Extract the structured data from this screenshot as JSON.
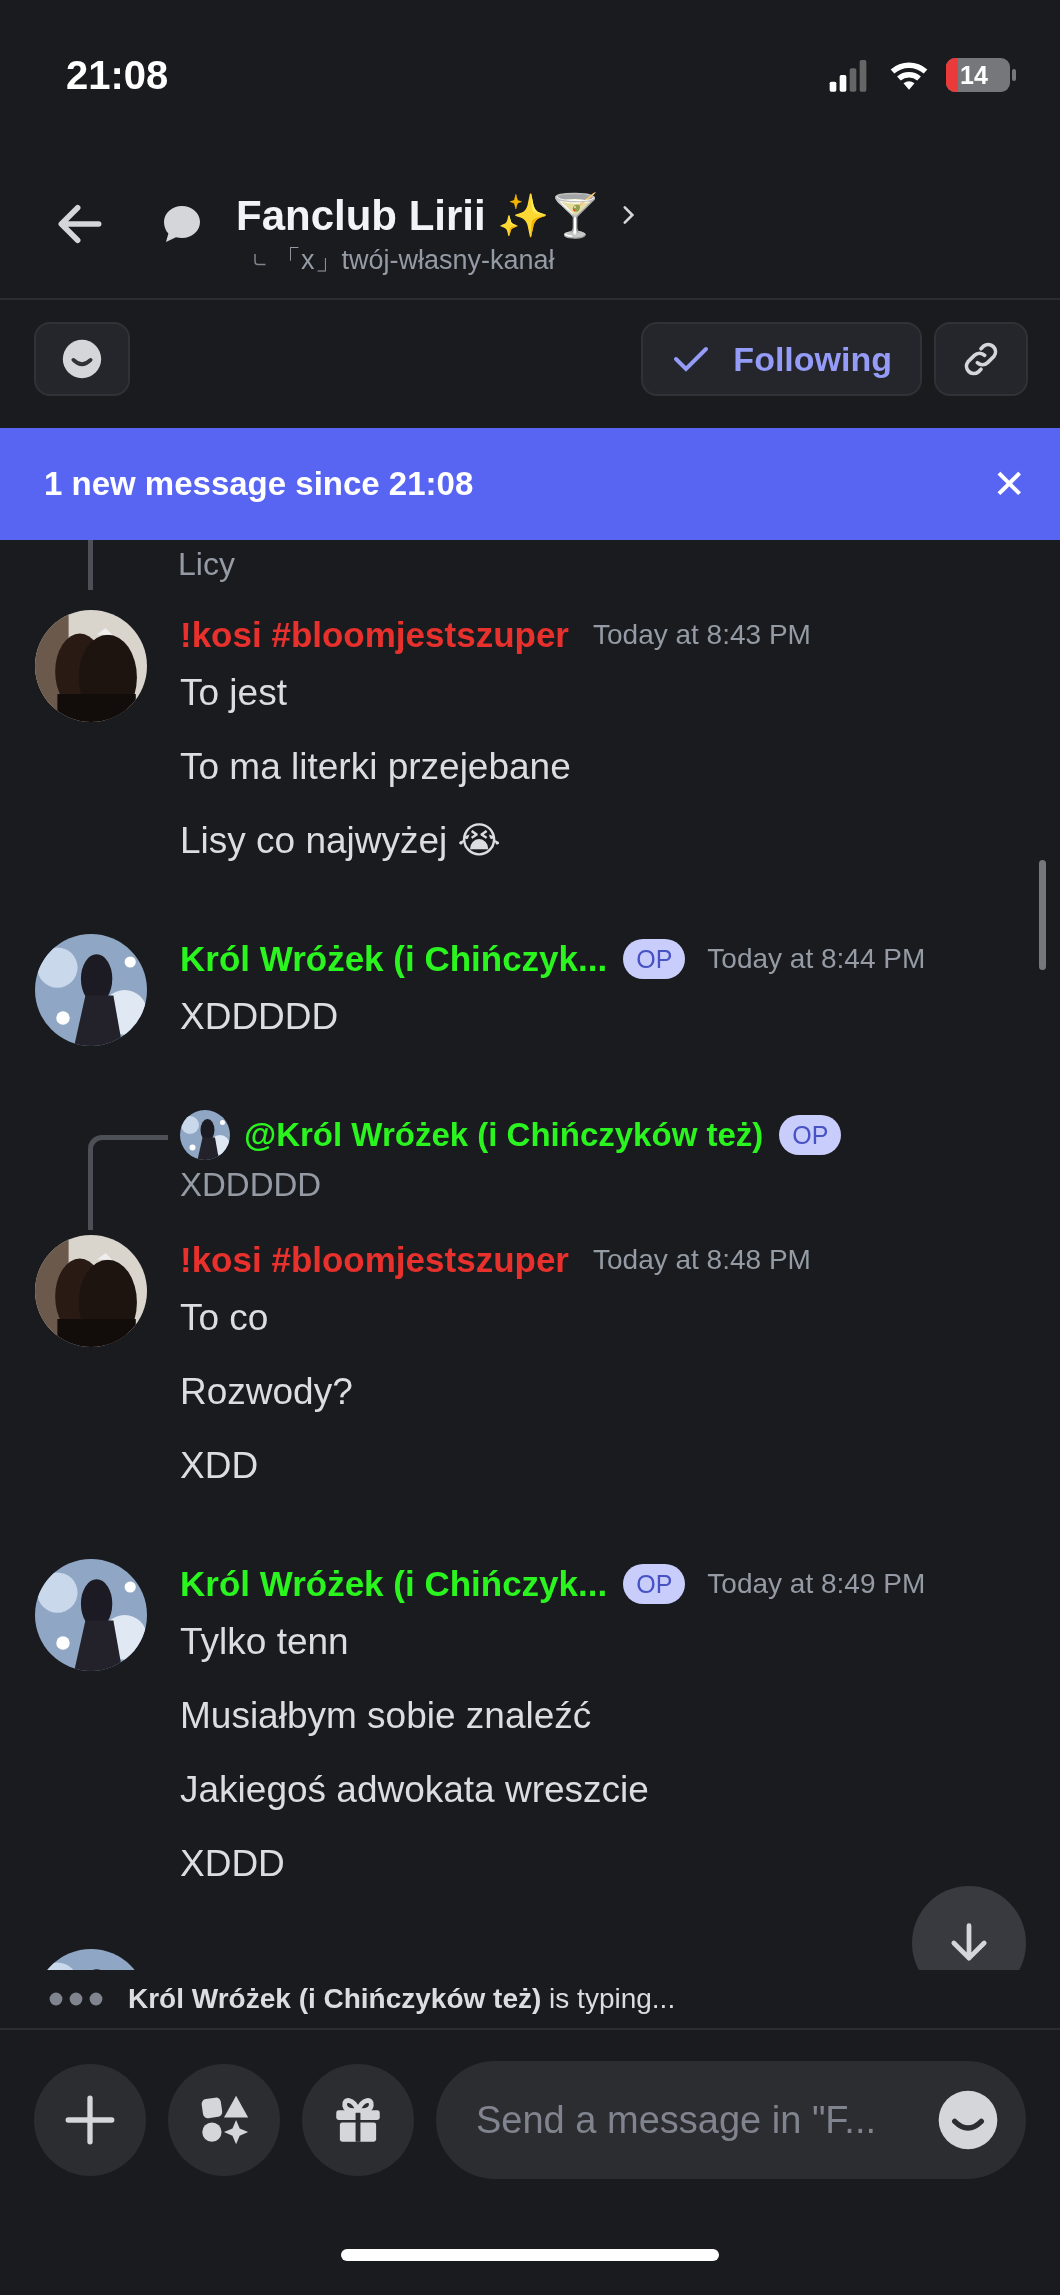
{
  "status_bar": {
    "time": "21:08",
    "battery": "14"
  },
  "header": {
    "title": "Fanclub Lirii ✨🍸",
    "subtitle": "「x」twój-własny-kanał"
  },
  "toolbar": {
    "following_label": "Following",
    "following": true
  },
  "banner": {
    "text": "1 new message since 21:08",
    "close": "✕"
  },
  "messages": [
    {
      "kind": "fragment",
      "text": "Licy"
    },
    {
      "kind": "message",
      "author": "!kosi #bloomjestszuper",
      "color": "#e8302c",
      "time": "Today at 8:43 PM",
      "lines": [
        "To jest",
        "To ma literki przejebane",
        "Lisy co najwyżej 😭"
      ]
    },
    {
      "kind": "message",
      "author": "Król Wróżek (i Chińczyk...",
      "color": "#2bf51f",
      "badge": "OP",
      "time": "Today at 8:44 PM",
      "lines": [
        "XDDDDD"
      ]
    },
    {
      "kind": "message",
      "author": "!kosi #bloomjestszuper",
      "color": "#e8302c",
      "time": "Today at 8:48 PM",
      "reply": {
        "author": "@Król Wróżek (i Chińczyków też)",
        "color": "#2bf51f",
        "badge": "OP",
        "text": "XDDDDD"
      },
      "lines": [
        "To co",
        "Rozwody?",
        "XDD"
      ]
    },
    {
      "kind": "message",
      "author": "Król Wróżek (i Chińczyk...",
      "color": "#2bf51f",
      "badge": "OP",
      "time": "Today at 8:49 PM",
      "lines": [
        "Tylko tenn",
        "Musiałbym sobie znaleźć",
        "Jakiegoś adwokata wreszcie",
        "XDDD"
      ]
    },
    {
      "kind": "peek"
    }
  ],
  "typing": {
    "text": "**Król Wróżek (i Chińczyków też)** is typing..."
  },
  "composer": {
    "placeholder": "Send a message in \"F..."
  }
}
